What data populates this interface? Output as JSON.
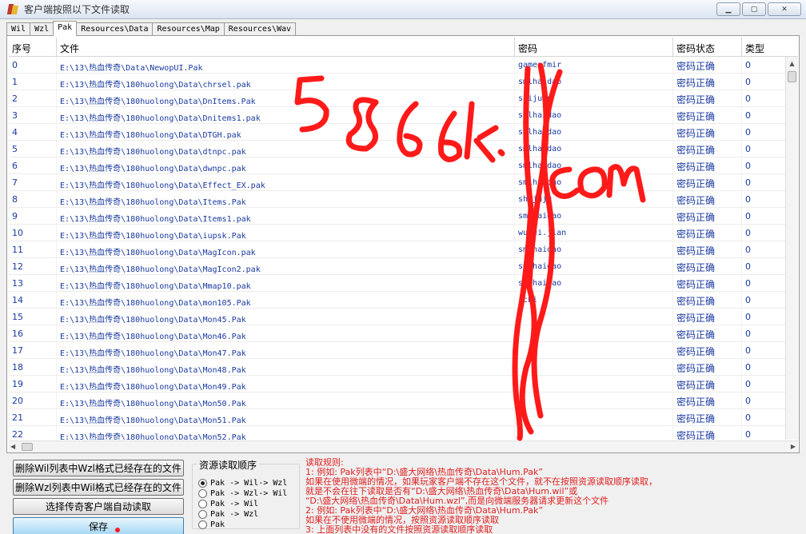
{
  "window": {
    "title": "客户端按照以下文件读取",
    "minimize": "▁",
    "maximize": "▢",
    "close": "✕"
  },
  "tabs": [
    {
      "label": "Wil",
      "active": false
    },
    {
      "label": "Wzl",
      "active": false
    },
    {
      "label": "Pak",
      "active": true
    },
    {
      "label": "Resources\\Data",
      "active": false
    },
    {
      "label": "Resources\\Map",
      "active": false
    },
    {
      "label": "Resources\\Wav",
      "active": false
    }
  ],
  "table": {
    "columns": [
      "序号",
      "文件",
      "密码",
      "密码状态",
      "类型"
    ],
    "rows": [
      {
        "idx": "0",
        "file": "E:\\13\\热血传奇\\Data\\NewopUI.Pak",
        "pwd": "gameofmir",
        "status": "密码正确",
        "type": "0"
      },
      {
        "idx": "1",
        "file": "E:\\13\\热血传奇\\180huolong\\Data\\chrsel.pak",
        "pwd": "smlhaidao",
        "status": "密码正确",
        "type": "0"
      },
      {
        "idx": "2",
        "file": "E:\\13\\热血传奇\\180huolong\\Data\\DnItems.Pak",
        "pwd": "shijuju",
        "status": "密码正确",
        "type": "0"
      },
      {
        "idx": "3",
        "file": "E:\\13\\热血传奇\\180huolong\\Data\\Dnitems1.pak",
        "pwd": "smlhaidao",
        "status": "密码正确",
        "type": "0"
      },
      {
        "idx": "4",
        "file": "E:\\13\\热血传奇\\180huolong\\Data\\DTGH.pak",
        "pwd": "smlhaidao",
        "status": "密码正确",
        "type": "0"
      },
      {
        "idx": "5",
        "file": "E:\\13\\热血传奇\\180huolong\\Data\\dtnpc.pak",
        "pwd": "smlhaidao",
        "status": "密码正确",
        "type": "0"
      },
      {
        "idx": "6",
        "file": "E:\\13\\热血传奇\\180huolong\\Data\\dwnpc.pak",
        "pwd": "smlhaidao",
        "status": "密码正确",
        "type": "0"
      },
      {
        "idx": "7",
        "file": "E:\\13\\热血传奇\\180huolong\\Data\\Effect_EX.pak",
        "pwd": "smlhaidao",
        "status": "密码正确",
        "type": "0"
      },
      {
        "idx": "8",
        "file": "E:\\13\\热血传奇\\180huolong\\Data\\Items.Pak",
        "pwd": "shijuju",
        "status": "密码正确",
        "type": "0"
      },
      {
        "idx": "9",
        "file": "E:\\13\\热血传奇\\180huolong\\Data\\Items1.pak",
        "pwd": "smlhaidao",
        "status": "密码正确",
        "type": "0"
      },
      {
        "idx": "10",
        "file": "E:\\13\\热血传奇\\180huolong\\Data\\iupsk.Pak",
        "pwd": "wuwei.jian",
        "status": "密码正确",
        "type": "0"
      },
      {
        "idx": "11",
        "file": "E:\\13\\热血传奇\\180huolong\\Data\\MagIcon.pak",
        "pwd": "smlhaidao",
        "status": "密码正确",
        "type": "0"
      },
      {
        "idx": "12",
        "file": "E:\\13\\热血传奇\\180huolong\\Data\\MagIcon2.pak",
        "pwd": "smlhaidao",
        "status": "密码正确",
        "type": "0"
      },
      {
        "idx": "13",
        "file": "E:\\13\\热血传奇\\180huolong\\Data\\Mmap10.pak",
        "pwd": "smlhaidao",
        "status": "密码正确",
        "type": "0"
      },
      {
        "idx": "14",
        "file": "E:\\13\\热血传奇\\180huolong\\Data\\mon105.Pak",
        "pwd": "ichi",
        "status": "密码正确",
        "type": "0"
      },
      {
        "idx": "15",
        "file": "E:\\13\\热血传奇\\180huolong\\Data\\Mon45.Pak",
        "pwd": "",
        "status": "密码正确",
        "type": "0"
      },
      {
        "idx": "16",
        "file": "E:\\13\\热血传奇\\180huolong\\Data\\Mon46.Pak",
        "pwd": "",
        "status": "密码正确",
        "type": "0"
      },
      {
        "idx": "17",
        "file": "E:\\13\\热血传奇\\180huolong\\Data\\Mon47.Pak",
        "pwd": "",
        "status": "密码正确",
        "type": "0"
      },
      {
        "idx": "18",
        "file": "E:\\13\\热血传奇\\180huolong\\Data\\Mon48.Pak",
        "pwd": "",
        "status": "密码正确",
        "type": "0"
      },
      {
        "idx": "19",
        "file": "E:\\13\\热血传奇\\180huolong\\Data\\Mon49.Pak",
        "pwd": "",
        "status": "密码正确",
        "type": "0"
      },
      {
        "idx": "20",
        "file": "E:\\13\\热血传奇\\180huolong\\Data\\Mon50.Pak",
        "pwd": "",
        "status": "密码正确",
        "type": "0"
      },
      {
        "idx": "21",
        "file": "E:\\13\\热血传奇\\180huolong\\Data\\Mon51.Pak",
        "pwd": "",
        "status": "密码正确",
        "type": "0"
      },
      {
        "idx": "22",
        "file": "E:\\13\\热血传奇\\180huolong\\Data\\Mon52.Pak",
        "pwd": "",
        "status": "密码正确",
        "type": "0"
      }
    ]
  },
  "buttons": {
    "del_wil": "删除Wil列表中Wzl格式已经存在的文件",
    "del_wzl": "删除Wzl列表中Wil格式已经存在的文件",
    "select_client": "选择传奇客户端自动读取",
    "save": "保存"
  },
  "resource_order": {
    "title": "资源读取顺序",
    "options": [
      {
        "label": "Pak -> Wil-> Wzl",
        "selected": true
      },
      {
        "label": "Pak -> Wzl-> Wil",
        "selected": false
      },
      {
        "label": "Pak -> Wil",
        "selected": false
      },
      {
        "label": "Pak -> Wzl",
        "selected": false
      },
      {
        "label": "Pak",
        "selected": false
      }
    ]
  },
  "rules": {
    "title": "读取规则:",
    "lines": [
      "1: 例如: Pak列表中“D:\\盛大网络\\热血传奇\\Data\\Hum.Pak”",
      "    如果在使用微端的情况，如果玩家客户端不存在这个文件，就不在按照资源读取顺序读取，",
      "    就是不会在往下读取是否有“D:\\盛大网络\\热血传奇\\Data\\Hum.wil”或",
      "  “D:\\盛大网络\\热血传奇\\Data\\Hum.wzl”,而是向微端服务器请求更新这个文件",
      "2: 例如: Pak列表中“D:\\盛大网络\\热血传奇\\Data\\Hum.Pak”",
      "    如果在不使用微端的情况，按照资源读取顺序读取",
      "3: 上面列表中没有的文件按照资源读取顺序读取"
    ]
  },
  "colors": {
    "link_blue": "#1a3aa0",
    "rule_red": "#e02020",
    "scribble_red": "#ff1a1a"
  }
}
